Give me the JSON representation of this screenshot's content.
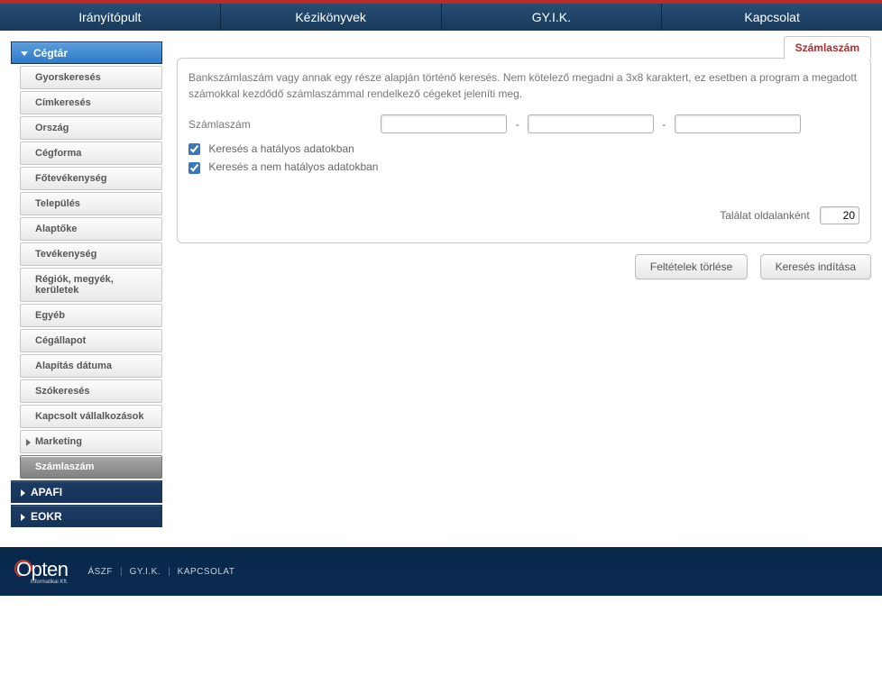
{
  "nav": {
    "items": [
      "Irányítópult",
      "Kézikönyvek",
      "GY.I.K.",
      "Kapcsolat"
    ]
  },
  "sidebar": {
    "cegtar_label": "Cégtár",
    "cegtar_items": [
      "Gyorskeresés",
      "Címkeresés",
      "Ország",
      "Cégforma",
      "Főtevékenység",
      "Település",
      "Alaptőke",
      "Tevékenység",
      "Régiók, megyék, kerületek",
      "Egyéb",
      "Cégállapot",
      "Alapítás dátuma",
      "Szókeresés",
      "Kapcsolt vállalkozások"
    ],
    "marketing_label": "Marketing",
    "szamlaszam_label": "Számlaszám",
    "apafi_label": "APAFI",
    "eokr_label": "EOKR"
  },
  "panel": {
    "tab_label": "Számlaszám",
    "description": "Bankszámlaszám vagy annak egy része alapján történő keresés. Nem kötelező megadni a 3x8 karaktert, ez esetben a program a megadott számokkal kezdődő számlaszámmal rendelkező cégeket jeleníti meg.",
    "field_label": "Számlaszám",
    "acct1": "",
    "acct2": "",
    "acct3": "",
    "chk1_label": "Keresés a hatályos adatokban",
    "chk2_label": "Keresés a nem hatályos adatokban",
    "results_label": "Találat oldalanként",
    "results_value": "20"
  },
  "actions": {
    "clear": "Feltételek törlése",
    "search": "Keresés indítása"
  },
  "footer": {
    "logo_text": "Opten",
    "logo_sub": "Informatikai Kft.",
    "links": [
      "ÁSZF",
      "GY.I.K.",
      "KAPCSOLAT"
    ]
  }
}
